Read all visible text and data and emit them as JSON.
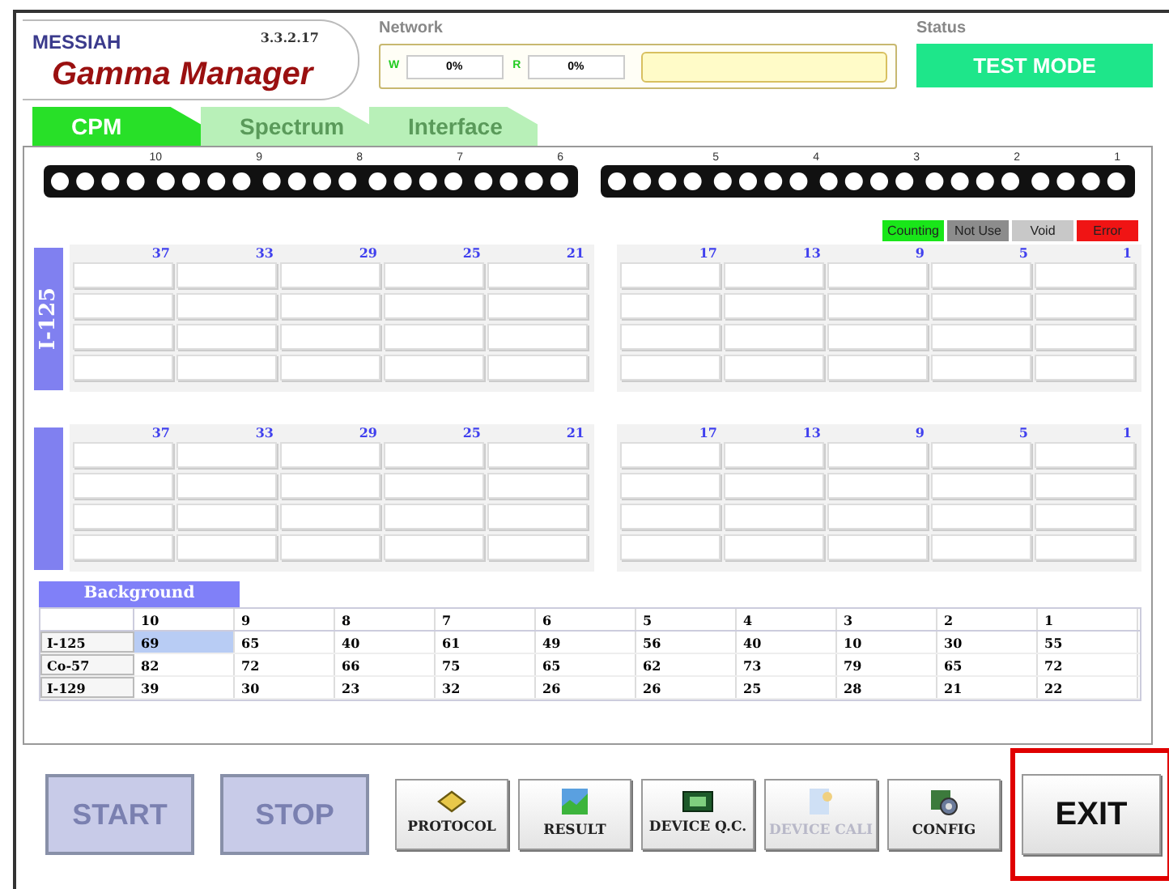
{
  "header": {
    "brand": "MESSIAH",
    "product": "Gamma Manager",
    "version": "3.3.2.17"
  },
  "network": {
    "label": "Network",
    "write_label": "W",
    "write_value": "0%",
    "read_label": "R",
    "read_value": "0%"
  },
  "status": {
    "label": "Status",
    "value": "TEST MODE"
  },
  "tabs": [
    {
      "label": "CPM",
      "selected": true
    },
    {
      "label": "Spectrum",
      "selected": false
    },
    {
      "label": "Interface",
      "selected": false
    }
  ],
  "detector_groups": [
    {
      "labels": [
        "10",
        "9",
        "8",
        "7",
        "6"
      ]
    },
    {
      "labels": [
        "5",
        "4",
        "3",
        "2",
        "1"
      ]
    }
  ],
  "legend": [
    {
      "label": "Counting",
      "color": "#19e619"
    },
    {
      "label": "Not Use",
      "color": "#8c8c8c"
    },
    {
      "label": "Void",
      "color": "#c8c8c8"
    },
    {
      "label": "Error",
      "color": "#f01414"
    }
  ],
  "sections": [
    {
      "isotope": "I-125",
      "column_labels": [
        "37",
        "33",
        "29",
        "25",
        "21",
        "17",
        "13",
        "9",
        "5",
        "1"
      ]
    },
    {
      "column_labels": [
        "37",
        "33",
        "29",
        "25",
        "21",
        "17",
        "13",
        "9",
        "5",
        "1"
      ]
    }
  ],
  "background": {
    "title": "Background",
    "columns": [
      "10",
      "9",
      "8",
      "7",
      "6",
      "5",
      "4",
      "3",
      "2",
      "1"
    ],
    "rows": [
      {
        "label": "I-125",
        "cells": [
          {
            "value": "69",
            "selected": true
          },
          {
            "value": "65",
            "selected": false
          },
          {
            "value": "40",
            "selected": false
          },
          {
            "value": "61",
            "selected": false
          },
          {
            "value": "49",
            "selected": false
          },
          {
            "value": "56",
            "selected": false
          },
          {
            "value": "40",
            "selected": false
          },
          {
            "value": "10",
            "selected": false
          },
          {
            "value": "30",
            "selected": false
          },
          {
            "value": "55",
            "selected": false
          }
        ]
      },
      {
        "label": "Co-57",
        "cells": [
          {
            "value": "82",
            "selected": false
          },
          {
            "value": "72",
            "selected": false
          },
          {
            "value": "66",
            "selected": false
          },
          {
            "value": "75",
            "selected": false
          },
          {
            "value": "65",
            "selected": false
          },
          {
            "value": "62",
            "selected": false
          },
          {
            "value": "73",
            "selected": false
          },
          {
            "value": "79",
            "selected": false
          },
          {
            "value": "65",
            "selected": false
          },
          {
            "value": "72",
            "selected": false
          }
        ]
      },
      {
        "label": "I-129",
        "cells": [
          {
            "value": "39",
            "selected": false
          },
          {
            "value": "30",
            "selected": false
          },
          {
            "value": "23",
            "selected": false
          },
          {
            "value": "32",
            "selected": false
          },
          {
            "value": "26",
            "selected": false
          },
          {
            "value": "26",
            "selected": false
          },
          {
            "value": "25",
            "selected": false
          },
          {
            "value": "28",
            "selected": false
          },
          {
            "value": "21",
            "selected": false
          },
          {
            "value": "22",
            "selected": false
          }
        ]
      }
    ]
  },
  "buttons": [
    {
      "label": "START",
      "kind": "big",
      "disabled": true,
      "highlighted": false
    },
    {
      "label": "STOP",
      "kind": "big",
      "disabled": true,
      "highlighted": false
    },
    {
      "label": "PROTOCOL",
      "kind": "tool",
      "disabled": false,
      "highlighted": false
    },
    {
      "label": "RESULT",
      "kind": "tool",
      "disabled": false,
      "highlighted": false
    },
    {
      "label": "DEVICE Q.C.",
      "kind": "tool",
      "disabled": false,
      "highlighted": false
    },
    {
      "label": "DEVICE CALI",
      "kind": "tool",
      "disabled": true,
      "highlighted": false
    },
    {
      "label": "CONFIG",
      "kind": "tool",
      "disabled": false,
      "highlighted": false
    },
    {
      "label": "EXIT",
      "kind": "exit",
      "disabled": false,
      "highlighted": true
    }
  ]
}
